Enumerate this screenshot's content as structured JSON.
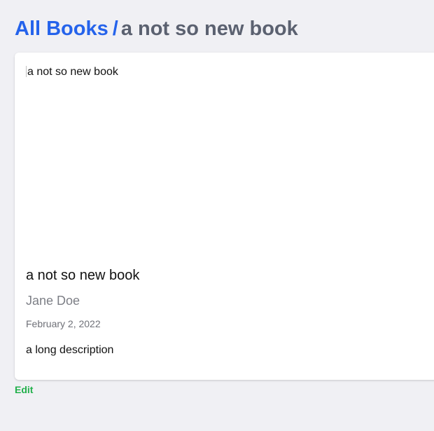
{
  "breadcrumb": {
    "root_label": "All Books",
    "separator": "/",
    "current_label": "a not so new book"
  },
  "book": {
    "cover_alt": "a not so new book",
    "title": "a not so new book",
    "author": "Jane Doe",
    "date": "February 2, 2022",
    "description": "a long description"
  },
  "actions": {
    "edit_label": "Edit"
  },
  "colors": {
    "link": "#2563eb",
    "current_crumb": "#5b6170",
    "edit": "#22b04b",
    "background": "#f0f0f4"
  }
}
